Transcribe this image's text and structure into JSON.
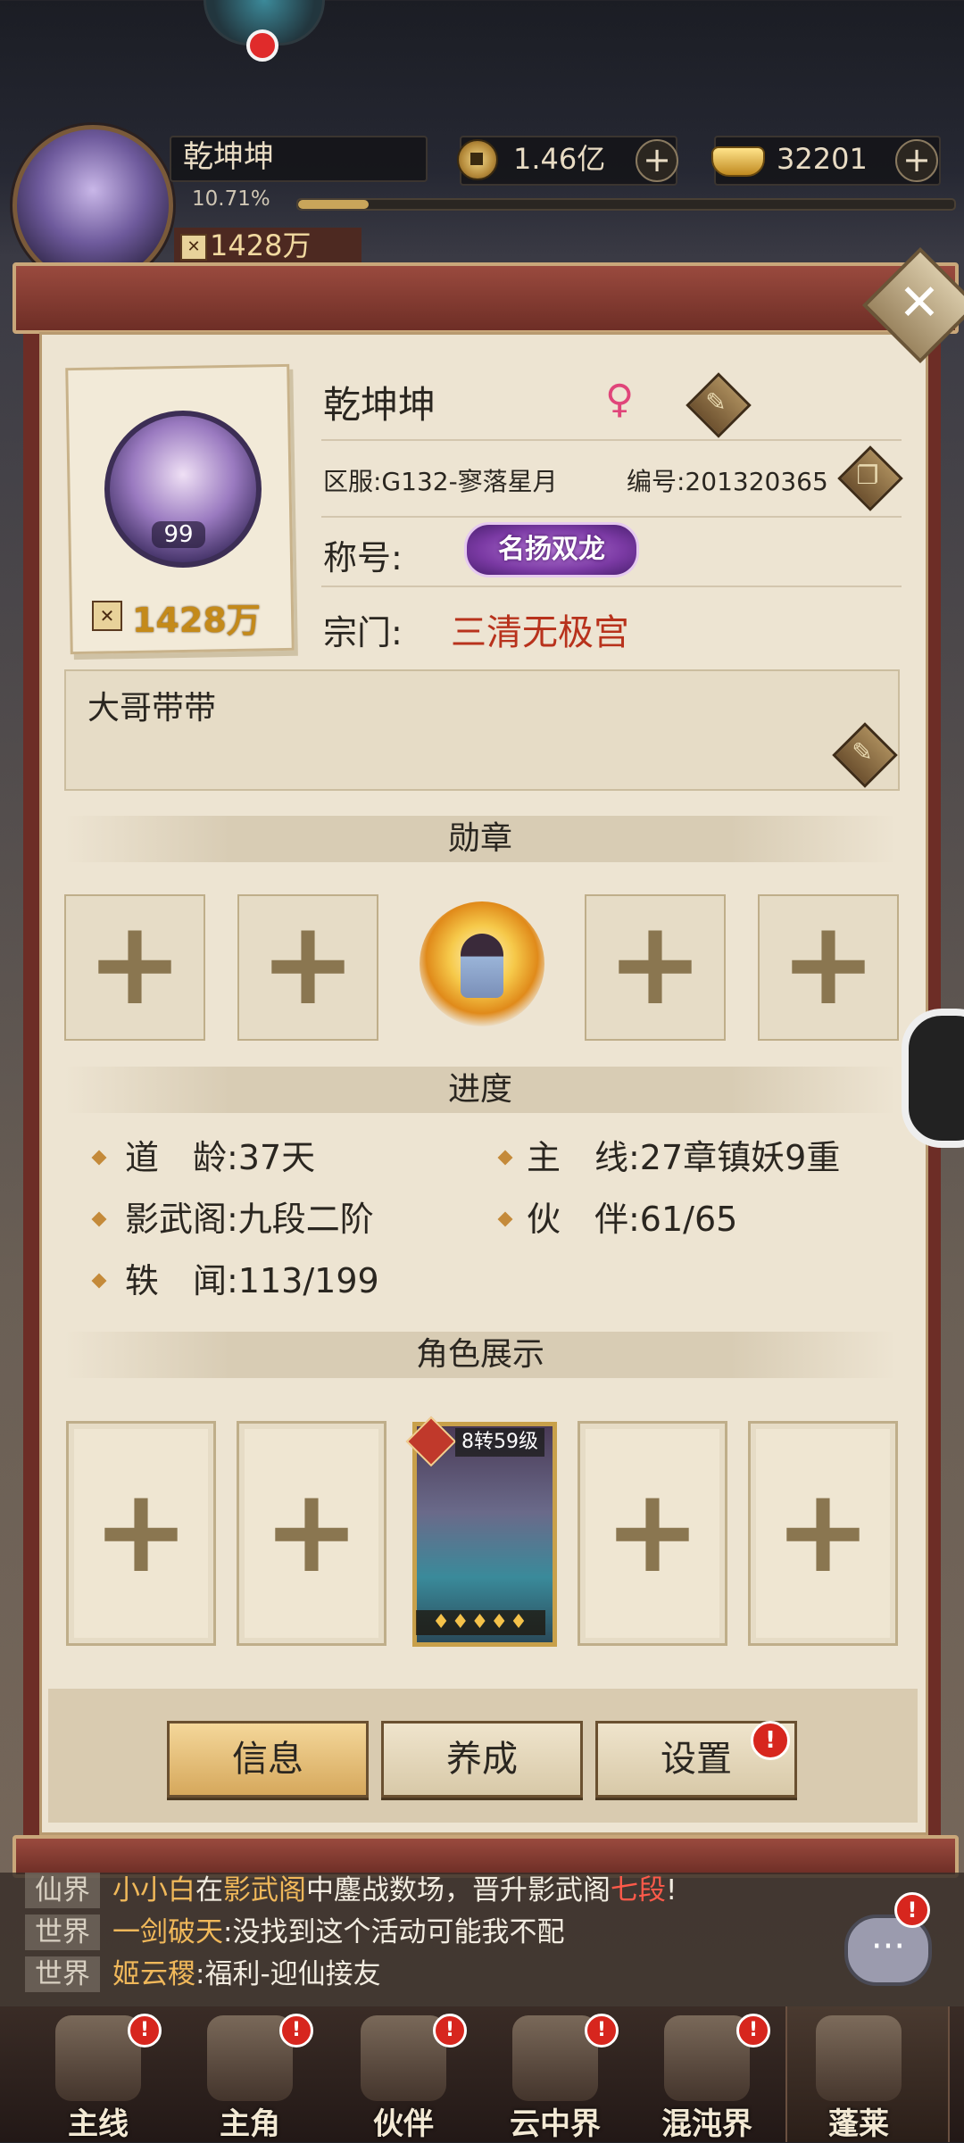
{
  "hud": {
    "player_name": "乾坤坤",
    "exp_percent_text": "10.71%",
    "exp_fraction": 0.1071,
    "power_text": "1428万",
    "coins": "1.46亿",
    "ingots": "32201",
    "plus": "+"
  },
  "profile": {
    "name": "乾坤坤",
    "gender_icon": "♀",
    "server": "区服:G132-寥落星月",
    "id_label": "编号:201320365",
    "title_label": "称号:",
    "title_value": "名扬双龙",
    "sect_label": "宗门:",
    "sect_value": "三清无极宫",
    "avatar_level": "99",
    "power": "1428万",
    "signature": "大哥带带"
  },
  "sections": {
    "medals": "勋章",
    "progress": "进度",
    "showcase": "角色展示"
  },
  "stats": {
    "age": "道　龄:37天",
    "main_line": "主　线:27章镇妖9重",
    "arena": "影武阁:九段二阶",
    "partner": "伙　伴:61/65",
    "rumor": "轶　闻:113/199"
  },
  "showcase": {
    "hero_level": "8转59级",
    "hero_stars": 5
  },
  "buttons": {
    "info": "信息",
    "cultivate": "养成",
    "settings": "设置",
    "badge": "!"
  },
  "chat": [
    {
      "tag": "仙界",
      "name": "小小白",
      "parts": [
        "在",
        "影武阁",
        "中鏖战数场，晋升影武阁",
        "七段",
        "!"
      ]
    },
    {
      "tag": "世界",
      "name": "一剑破天",
      "text": ":没找到这个活动可能我不配"
    },
    {
      "tag": "世界",
      "name": "姬云稷",
      "text": ":福利-迎仙接友"
    }
  ],
  "nav": [
    {
      "label": "主线",
      "badge": "!"
    },
    {
      "label": "主角",
      "badge": "!"
    },
    {
      "label": "伙伴",
      "badge": "!"
    },
    {
      "label": "云中界",
      "badge": "!"
    },
    {
      "label": "混沌界",
      "badge": "!"
    },
    {
      "label": "蓬莱",
      "badge": ""
    }
  ],
  "colors": {
    "accent_gold": "#c48a1a",
    "sect_red": "#b8321c",
    "badge_red": "#d7261e",
    "title_purple": "#7b3aa4"
  }
}
